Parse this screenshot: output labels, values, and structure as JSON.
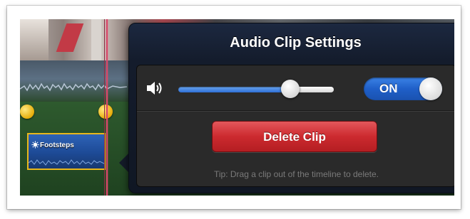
{
  "popover": {
    "title": "Audio Clip Settings",
    "volume_level": 0.72,
    "toggle": {
      "label": "ON",
      "state": true
    },
    "delete_button": "Delete Clip",
    "tip": "Tip: Drag a clip out of the timeline to delete."
  },
  "timeline": {
    "clip": {
      "label": "Footsteps",
      "icon": "sound-effect-icon"
    }
  },
  "colors": {
    "accent_blue": "#2e6fd6",
    "delete_red": "#cc2a2f",
    "playhead": "#d8486a",
    "handle_yellow": "#e6ad0b"
  }
}
